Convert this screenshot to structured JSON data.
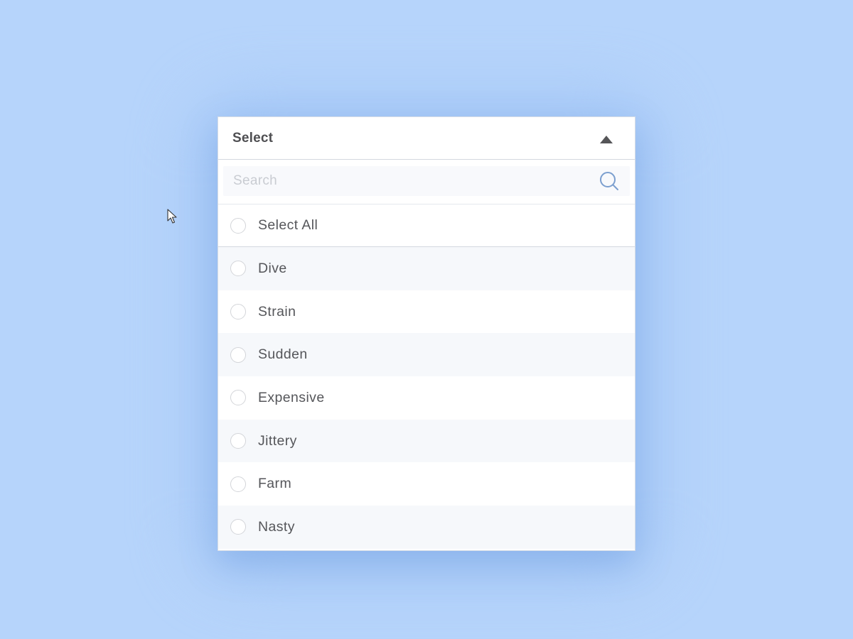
{
  "dropdown": {
    "title": "Select",
    "state": "expanded",
    "search": {
      "placeholder": "Search",
      "value": "",
      "icon": "search-icon"
    },
    "select_all": {
      "label": "Select All",
      "checked": false
    },
    "options": [
      {
        "label": "Dive",
        "checked": false
      },
      {
        "label": "Strain",
        "checked": false
      },
      {
        "label": "Sudden",
        "checked": false
      },
      {
        "label": "Expensive",
        "checked": false
      },
      {
        "label": "Jittery",
        "checked": false
      },
      {
        "label": "Farm",
        "checked": false
      },
      {
        "label": "Nasty",
        "checked": false
      }
    ]
  },
  "colors": {
    "background": "#b6d4fb",
    "panel": "#ffffff",
    "row_alt": "#f6f8fb",
    "text": "#55565a",
    "title": "#4f4f52",
    "search_icon": "#7c9fcf"
  }
}
